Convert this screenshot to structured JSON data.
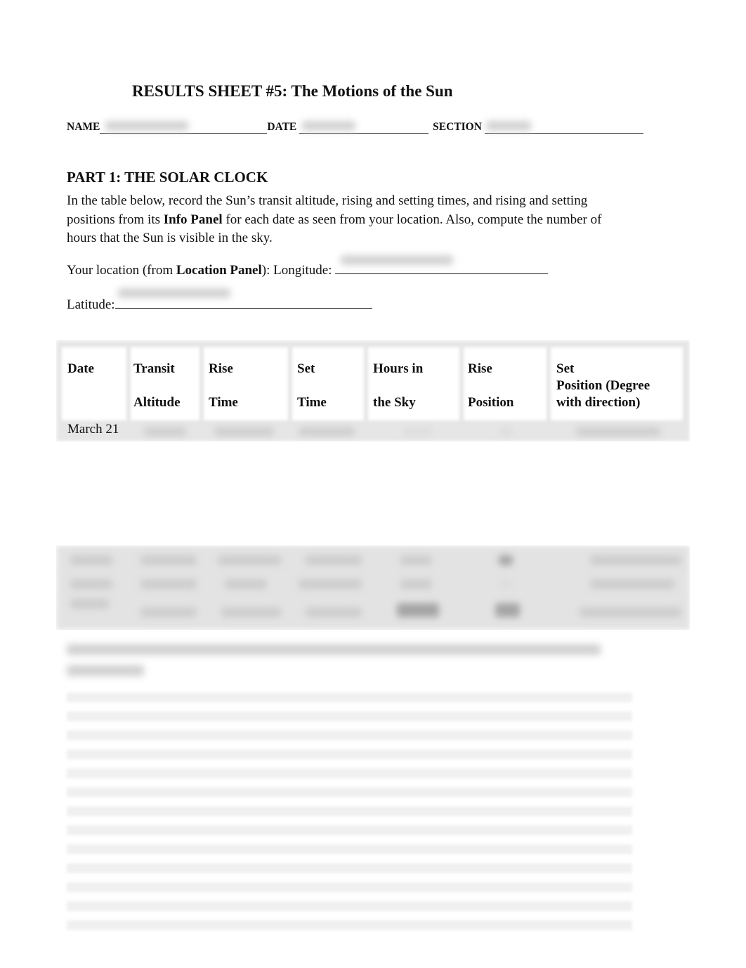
{
  "document": {
    "title": "RESULTS SHEET #5: The Motions of the Sun",
    "header_fields": {
      "name_label": "NAME",
      "date_label": "DATE",
      "section_label": "SECTION",
      "name_value": "[redacted]",
      "date_value": "[redacted]",
      "section_value": "[redacted]"
    },
    "part1": {
      "heading": "PART 1: THE SOLAR CLOCK",
      "instructions_pre": "In the table below, record the Sun’s transit altitude, rising and setting times, and rising and setting positions from its ",
      "instructions_bold": "Info Panel",
      "instructions_post": " for each date as seen from your location. Also, compute the number of hours that the Sun is visible in the sky.",
      "location_pre": "Your location (from ",
      "location_bold": "Location Panel",
      "location_post": "): Longitude: ",
      "longitude_value": "[redacted]",
      "latitude_label": "Latitude:",
      "latitude_value": "[redacted]"
    },
    "table": {
      "headers": [
        {
          "line1": "Date",
          "line2": ""
        },
        {
          "line1": "Transit",
          "line2": "Altitude"
        },
        {
          "line1": "Rise",
          "line2": "Time"
        },
        {
          "line1": "Set",
          "line2": "Time"
        },
        {
          "line1": "Hours in",
          "line2": "the Sky"
        },
        {
          "line1": "Rise",
          "line2": "Position"
        },
        {
          "line1": "Set",
          "line2": "Position (Degree",
          "line3": "with direction)"
        }
      ],
      "rows": [
        {
          "date": "March 21",
          "cells": "[redacted]"
        },
        {
          "date": "[redacted]",
          "cells": "[redacted]"
        },
        {
          "date": "[redacted]",
          "cells": "[redacted]"
        },
        {
          "date": "[redacted]",
          "cells": "[redacted]"
        }
      ]
    },
    "question": {
      "text": "[redacted]",
      "answer": "[redacted]"
    }
  }
}
